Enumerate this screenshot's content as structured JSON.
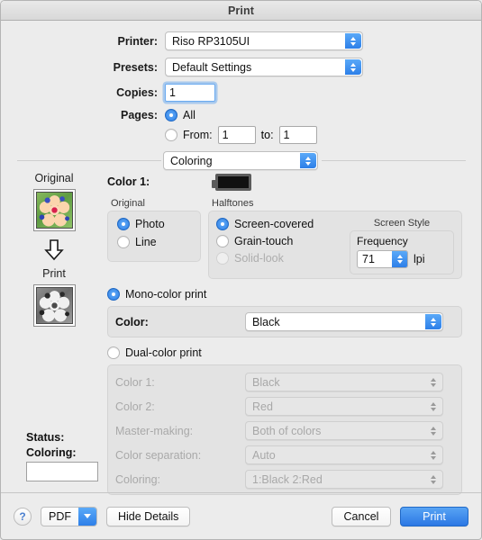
{
  "window": {
    "title": "Print"
  },
  "top": {
    "printer_label": "Printer:",
    "printer_value": "Riso RP3105UI",
    "presets_label": "Presets:",
    "presets_value": "Default Settings",
    "copies_label": "Copies:",
    "copies_value": "1",
    "pages_label": "Pages:",
    "pages_all_label": "All",
    "pages_from_label": "From:",
    "pages_from_value": "1",
    "pages_to_label": "to:",
    "pages_to_value": "1"
  },
  "pane": {
    "selected": "Coloring"
  },
  "preview": {
    "original_label": "Original",
    "print_label": "Print",
    "arrow_icon": "arrow-down-icon",
    "status_label": "Status:",
    "coloring_label": "Coloring:",
    "status_value": ""
  },
  "coloring": {
    "color1_label": "Color 1:",
    "color1_swatch_color": "#111111",
    "original_group_label": "Original",
    "original_options": [
      {
        "label": "Photo",
        "selected": true,
        "disabled": false
      },
      {
        "label": "Line",
        "selected": false,
        "disabled": false
      }
    ],
    "halftones_group_label": "Halftones",
    "halftone_options": [
      {
        "label": "Screen-covered",
        "selected": true,
        "disabled": false
      },
      {
        "label": "Grain-touch",
        "selected": false,
        "disabled": false
      },
      {
        "label": "Solid-look",
        "selected": false,
        "disabled": true
      }
    ],
    "screen_style_label": "Screen Style",
    "frequency_label": "Frequency",
    "frequency_value": "71",
    "frequency_unit": "lpi",
    "mono_label": "Mono-color print",
    "mono_selected": true,
    "mono_color_label": "Color:",
    "mono_color_value": "Black",
    "dual_label": "Dual-color print",
    "dual_selected": false,
    "dual_rows": [
      {
        "label": "Color 1:",
        "value": "Black"
      },
      {
        "label": "Color 2:",
        "value": "Red"
      },
      {
        "label": "Master-making:",
        "value": "Both of colors"
      },
      {
        "label": "Color separation:",
        "value": "Auto"
      },
      {
        "label": "Coloring:",
        "value": "1:Black 2:Red"
      }
    ]
  },
  "footer": {
    "help_label": "?",
    "pdf_label": "PDF",
    "details_label": "Hide Details",
    "cancel_label": "Cancel",
    "print_label": "Print"
  },
  "colors": {
    "accent_blue": "#2d80e8",
    "window_bg": "#ececec",
    "group_bg": "#e3e3e3"
  }
}
